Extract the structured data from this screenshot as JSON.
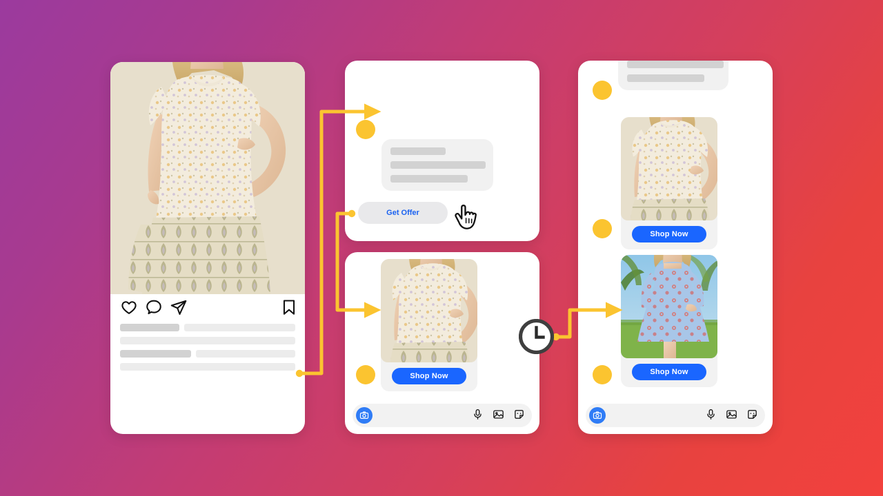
{
  "theme": {
    "bg_gradient_start": "#9B3A9E",
    "bg_gradient_mid": "#D53F5C",
    "bg_gradient_end": "#F2413D",
    "accent_yellow": "#FBC430",
    "accent_blue": "#1A66FF",
    "link_blue": "#1A62F0",
    "card_bg": "#FFFFFF",
    "bubble_gray": "#F1F1F1",
    "skeleton_gray": "#ECECEC",
    "skeleton_dark": "#D2D2D2"
  },
  "instagram_post": {
    "name": "instagram-post-card",
    "photo_alt": "model wearing cream floral ruffle-sleeve dress",
    "actions": [
      {
        "name": "like-icon",
        "label": "heart-icon"
      },
      {
        "name": "comment-icon",
        "label": "comment-icon"
      },
      {
        "name": "share-icon",
        "label": "paper-plane-icon"
      },
      {
        "name": "save-icon",
        "label": "bookmark-icon"
      }
    ],
    "caption_placeholder_rows": 4,
    "comment_placeholder_rows": 1
  },
  "chat_a": {
    "name": "chat-card-offer",
    "bubble_lines": 3,
    "offer_button_label": "Get Offer",
    "cursor": "pointing-hand-cursor"
  },
  "chat_b": {
    "name": "chat-card-product",
    "product_image_alt": "cream floral ruffle-sleeve dress",
    "shop_button_label": "Shop Now",
    "composer": {
      "camera_icon": "camera-icon",
      "tools": [
        "microphone-icon",
        "image-icon",
        "sticker-icon"
      ]
    }
  },
  "chat_c": {
    "name": "chat-card-followup",
    "bubble_lines": 2,
    "products": [
      {
        "image_alt": "cream floral ruffle-sleeve dress",
        "shop_button_label": "Shop Now"
      },
      {
        "image_alt": "blue and red print tiered dress outdoors",
        "shop_button_label": "Shop Now"
      }
    ],
    "composer": {
      "camera_icon": "camera-icon",
      "tools": [
        "microphone-icon",
        "image-icon",
        "sticker-icon"
      ]
    }
  },
  "flow": {
    "delay_badge": "clock-icon",
    "connector_color": "#FBC430",
    "steps": [
      "instagram-post-to-chat-bubble",
      "get-offer-to-product-card",
      "clock-delay-to-followup-product"
    ]
  }
}
